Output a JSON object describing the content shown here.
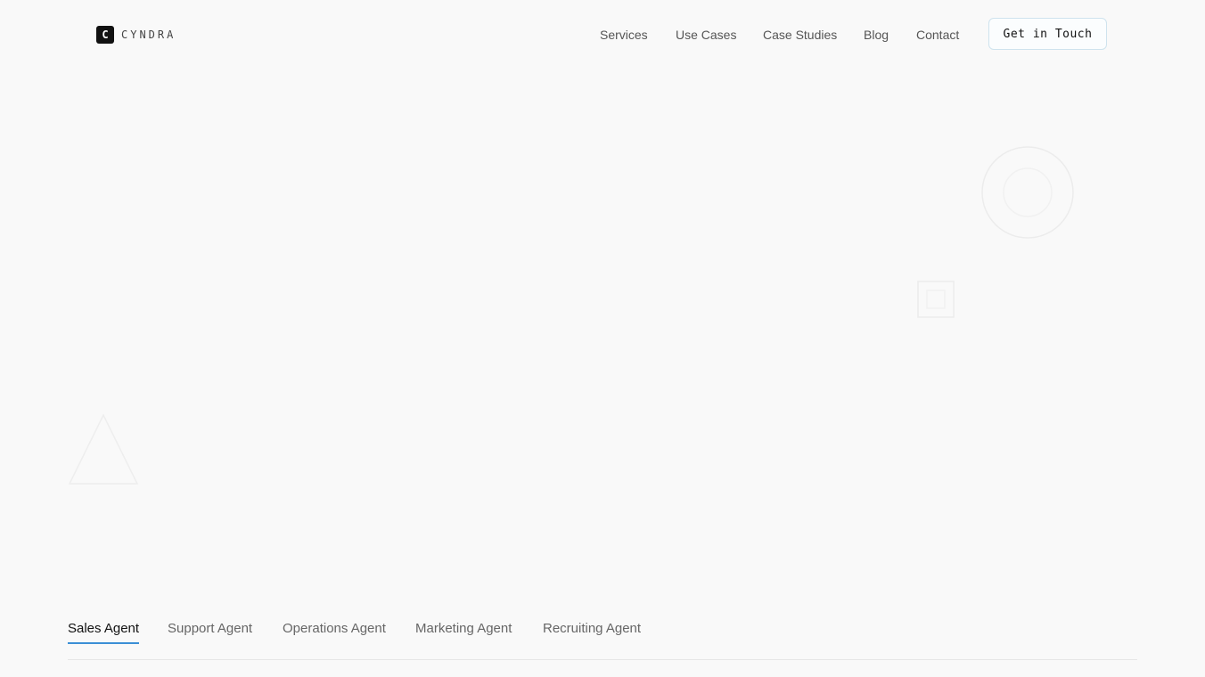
{
  "brand": {
    "mark": "C",
    "name": "CYNDRA"
  },
  "nav": {
    "items": [
      {
        "label": "Services"
      },
      {
        "label": "Use Cases"
      },
      {
        "label": "Case Studies"
      },
      {
        "label": "Blog"
      },
      {
        "label": "Contact"
      }
    ],
    "cta_label": "Get in Touch"
  },
  "decorations": [
    "circle-icon",
    "square-icon",
    "triangle-icon"
  ],
  "tabs": {
    "active_index": 0,
    "items": [
      {
        "label": "Sales Agent"
      },
      {
        "label": "Support Agent"
      },
      {
        "label": "Operations Agent"
      },
      {
        "label": "Marketing Agent"
      },
      {
        "label": "Recruiting Agent"
      }
    ]
  },
  "colors": {
    "background": "#f9f9f9",
    "accent": "#3b8fd6",
    "text": "#111111"
  }
}
